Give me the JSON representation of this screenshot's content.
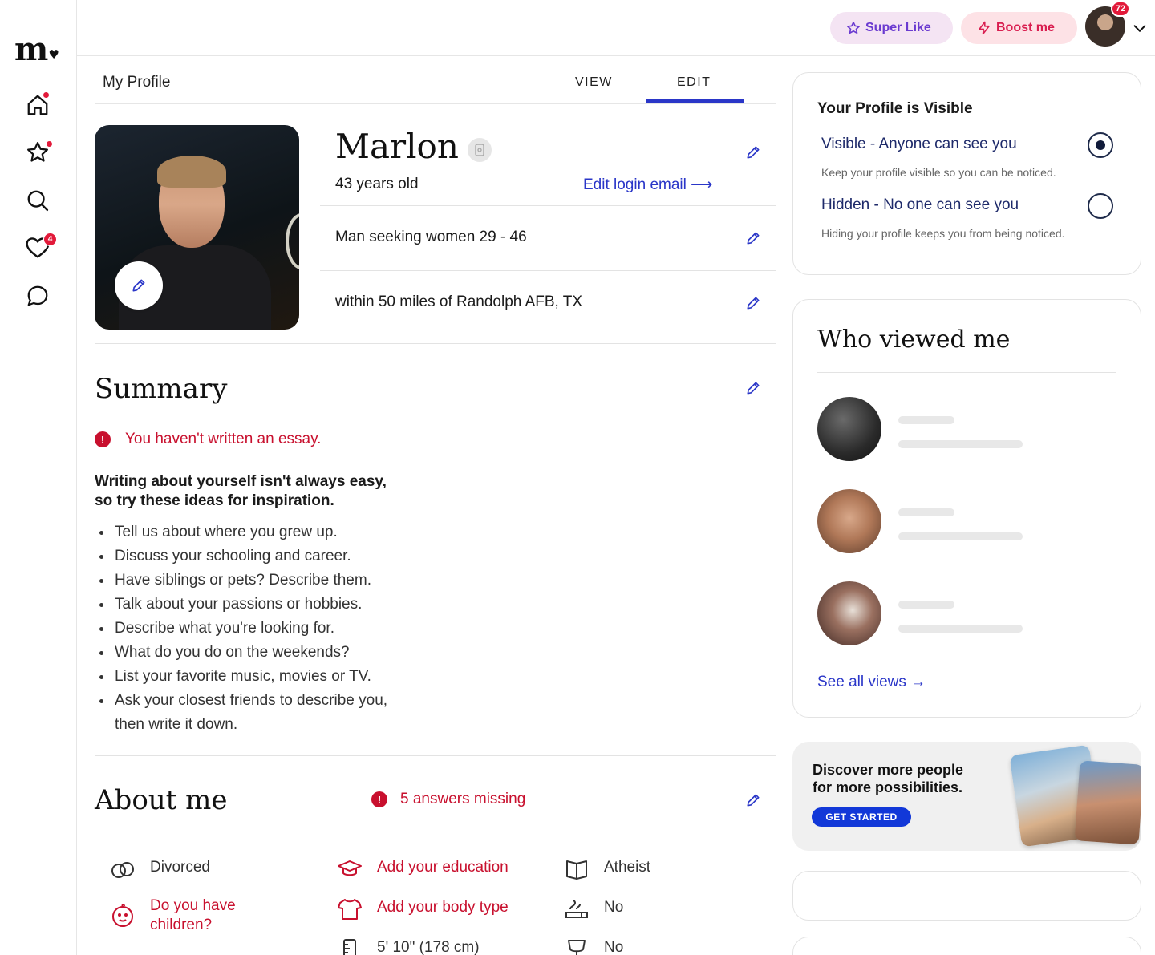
{
  "brand": {
    "logo_text": "m"
  },
  "sidebar": {
    "items": [
      {
        "name": "home",
        "indicator": "dot"
      },
      {
        "name": "favorites",
        "indicator": "dot"
      },
      {
        "name": "search",
        "indicator": ""
      },
      {
        "name": "likes",
        "indicator": "4"
      },
      {
        "name": "messages",
        "indicator": ""
      }
    ]
  },
  "topbar": {
    "super_like_label": "Super Like",
    "boost_label": "Boost me",
    "notification_count": "72"
  },
  "tabs": {
    "page_label": "My Profile",
    "view_label": "VIEW",
    "edit_label": "EDIT",
    "active": "EDIT"
  },
  "profile": {
    "name": "Marlon",
    "age_text": "43 years old",
    "edit_email_label": "Edit login email",
    "seeking_text": "Man seeking women 29 - 46",
    "location_text": "within 50 miles of Randolph AFB, TX"
  },
  "summary": {
    "title": "Summary",
    "warning": "You haven't written an essay.",
    "inspiration_line1": "Writing about yourself isn't always easy,",
    "inspiration_line2": "so try these ideas for inspiration.",
    "ideas": [
      "Tell us about where you grew up.",
      "Discuss your schooling and career.",
      "Have siblings or pets? Describe them.",
      "Talk about your passions or hobbies.",
      "Describe what you're looking for.",
      "What do you do on the weekends?",
      "List your favorite music, movies or TV.",
      "Ask your closest friends to describe you, then write it down."
    ]
  },
  "about": {
    "title": "About me",
    "missing_text": "5 answers missing",
    "items": [
      {
        "label": "Divorced",
        "status": "filled",
        "icon": "rings-icon"
      },
      {
        "label": "Add your education",
        "status": "missing",
        "icon": "graduation-cap-icon"
      },
      {
        "label": "Atheist",
        "status": "filled",
        "icon": "book-icon"
      },
      {
        "label": "Do you have children?",
        "status": "missing",
        "icon": "baby-face-icon"
      },
      {
        "label": "Add your body type",
        "status": "missing",
        "icon": "shirt-icon"
      },
      {
        "label": "No",
        "status": "filled",
        "icon": "smoking-icon"
      },
      {
        "label": "5' 10\" (178 cm)",
        "status": "filled",
        "icon": "ruler-icon"
      },
      {
        "label": "No",
        "status": "filled",
        "icon": "drink-icon"
      }
    ]
  },
  "visibility": {
    "title": "Your Profile is Visible",
    "visible_label": "Visible - Anyone can see you",
    "visible_sub": "Keep your profile visible so you can be noticed.",
    "hidden_label": "Hidden - No one can see you",
    "hidden_sub": "Hiding your profile keeps you from being noticed.",
    "selected": "visible"
  },
  "who_viewed": {
    "title": "Who viewed me",
    "see_all_label": "See all views"
  },
  "promo": {
    "line1": "Discover more people",
    "line2": "for more possibilities.",
    "button_label": "GET STARTED"
  },
  "colors": {
    "accent_blue": "#2a36c8",
    "error_red": "#c8102e",
    "notification_red": "#e21a3a",
    "super_like_purple": "#6a3ad0",
    "boost_pink": "#d91e50"
  }
}
